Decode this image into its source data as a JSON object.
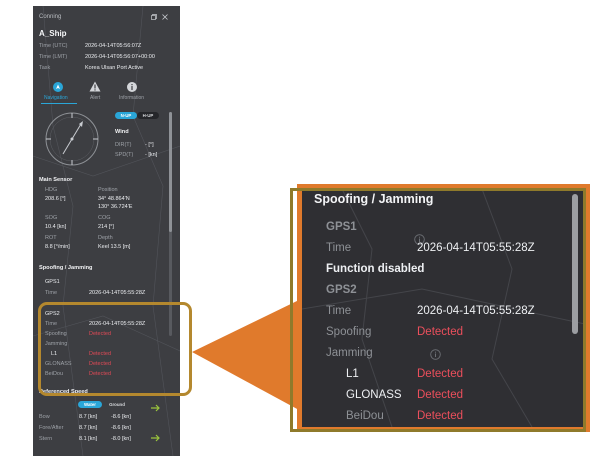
{
  "panel": {
    "title": "Conning",
    "ship_name": "A_Ship",
    "info": [
      {
        "label": "Time (UTC)",
        "value": "2026-04-14T05:56:07Z"
      },
      {
        "label": "Time (LMT)",
        "value": "2026-04-14T05:56:07+00:00"
      },
      {
        "label": "Task",
        "value": "Korea Ulsan Port Active"
      }
    ],
    "tabs": [
      "Navigation",
      "Alert",
      "Information"
    ],
    "compass_toggle": [
      "N-UP",
      "H-UP"
    ],
    "wind": {
      "title": "Wind",
      "dir_label": "DIR(T)",
      "dir_value": "- [°]",
      "spd_label": "SPD(T)",
      "spd_value": "- [kn]"
    },
    "main_sensor": {
      "title": "Main Sensor",
      "hdg_label": "HDG",
      "hdg_value": "208.6 [°]",
      "position_label": "Position",
      "position_lat": "34° 48.864'N",
      "position_lon": "130° 36.724'E",
      "sog_label": "SOG",
      "sog_value": "10.4 [kn]",
      "cog_label": "COG",
      "cog_value": "214 [°]",
      "rot_label": "ROT",
      "rot_value": "8.8 [°/min]",
      "depth_label": "Depth",
      "depth_value": "Keel 13.5 [m]"
    },
    "spoofing": {
      "title": "Spoofing / Jamming",
      "gps1_label": "GPS1",
      "gps1_time_label": "Time",
      "gps1_time": "2026-04-14T05:55:28Z",
      "gps2_label": "GPS2",
      "gps2_time_label": "Time",
      "gps2_time": "2026-04-14T05:55:28Z",
      "spoofing_label": "Spoofing",
      "spoofing_value": "Detected",
      "jamming_label": "Jamming",
      "l1_label": "L1",
      "l1_value": "Detected",
      "glonass_label": "GLONASS",
      "glonass_value": "Detected",
      "beidou_label": "BeiDou",
      "beidou_value": "Detected"
    },
    "speed": {
      "title": "Referenced Speed",
      "toggle": [
        "Water",
        "Ground"
      ],
      "rows": [
        {
          "label": "Bow",
          "water": "8.7 [kn]",
          "ground": "-8.6 [kn]"
        },
        {
          "label": "Fore/After",
          "water": "8.7 [kn]",
          "ground": "-8.6 [kn]"
        },
        {
          "label": "Stern",
          "water": "8.1 [kn]",
          "ground": "-8.0 [kn]"
        }
      ]
    }
  },
  "zoom": {
    "title": "Spoofing / Jamming",
    "gps1_label": "GPS1",
    "gps1_time_label": "Time",
    "gps1_time": "2026-04-14T05:55:28Z",
    "function_disabled": "Function disabled",
    "gps2_label": "GPS2",
    "gps2_time_label": "Time",
    "gps2_time": "2026-04-14T05:55:28Z",
    "spoofing_label": "Spoofing",
    "spoofing_value": "Detected",
    "jamming_label": "Jamming",
    "l1_label": "L1",
    "l1_value": "Detected",
    "glonass_label": "GLONASS",
    "glonass_value": "Detected",
    "beidou_label": "BeiDou",
    "beidou_value": "Detected"
  },
  "colors": {
    "panel_bg": "#3d3e42",
    "detected": "#e04a56",
    "accent": "#2aa6d8",
    "callout_orange": "#e07a2c",
    "highlight_olive": "#b4882e"
  },
  "icons": [
    "restore-icon",
    "close-icon",
    "navigation-icon",
    "alert-icon",
    "information-icon",
    "compass-icon",
    "info-circle-icon",
    "arrow-right-icon"
  ]
}
